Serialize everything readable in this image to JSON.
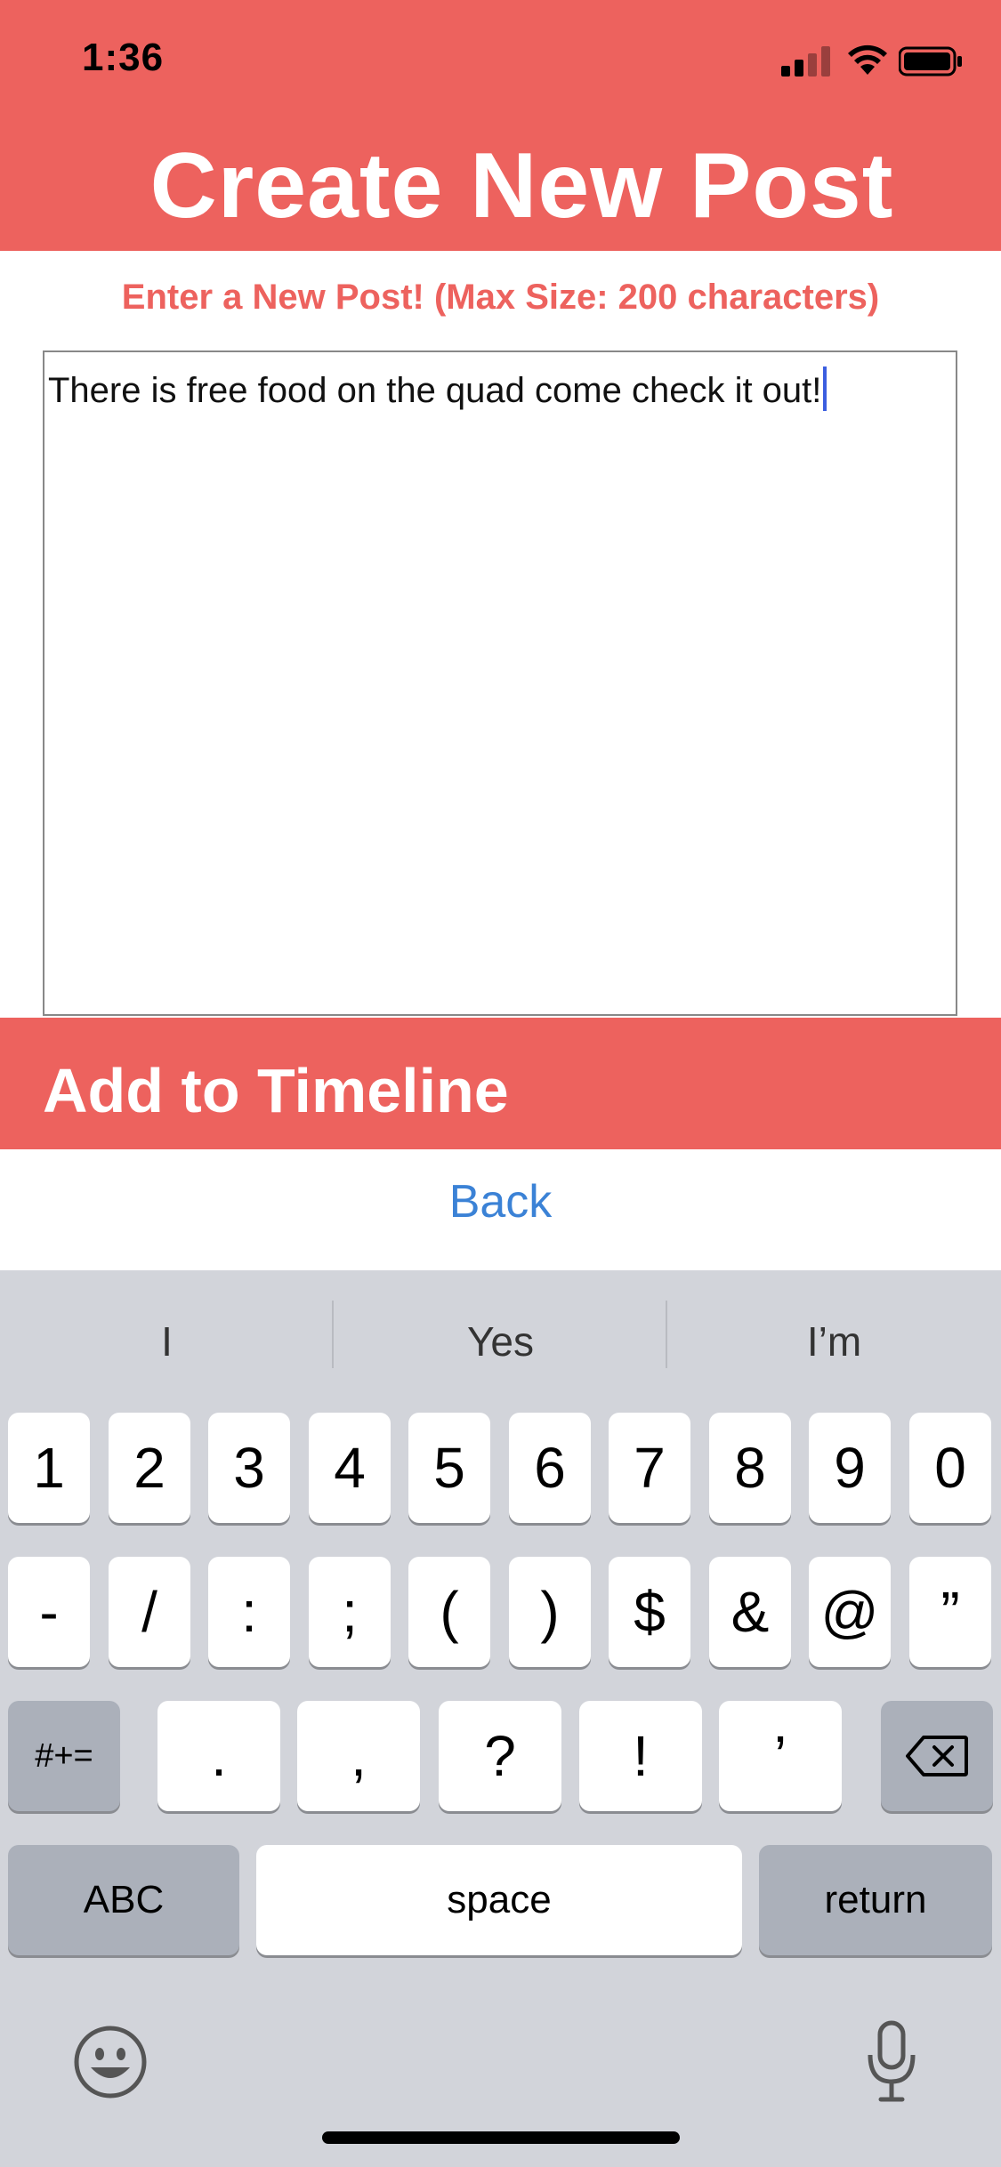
{
  "status_bar": {
    "time": "1:36"
  },
  "header": {
    "title": "Create New Post"
  },
  "prompt": "Enter a New Post! (Max Size: 200 characters)",
  "post_input": {
    "value": "There is free food on the quad come check it out!"
  },
  "add_button": {
    "label": "Add to Timeline"
  },
  "back_button": {
    "label": "Back"
  },
  "keyboard": {
    "suggestions": [
      "I",
      "Yes",
      "I’m"
    ],
    "numbers": [
      "1",
      "2",
      "3",
      "4",
      "5",
      "6",
      "7",
      "8",
      "9",
      "0"
    ],
    "symbols": [
      "-",
      "/",
      ":",
      ";",
      "(",
      ")",
      "$",
      "&",
      "@",
      "”"
    ],
    "shift_key": "#+=",
    "punctuation": [
      ".",
      ",",
      "?",
      "!",
      "’"
    ],
    "abc_key": "ABC",
    "space_key": "space",
    "return_key": "return",
    "icons": {
      "delete": "backspace-icon",
      "emoji": "emoji-icon",
      "mic": "microphone-icon"
    }
  },
  "colors": {
    "accent": "#ED625E",
    "link": "#3B82D6",
    "keyboard_bg": "#D2D4DA",
    "caret": "#3B5EE0"
  }
}
